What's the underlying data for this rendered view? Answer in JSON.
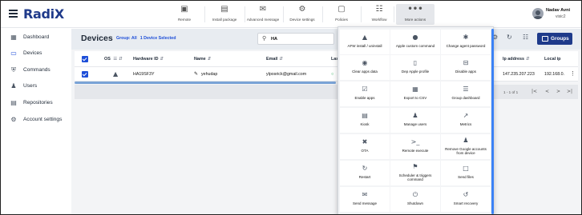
{
  "app": {
    "logo": "RadiX"
  },
  "toolbar": {
    "items": [
      {
        "label": "Remote",
        "icon": "monitor-icon"
      },
      {
        "label": "Install package",
        "icon": "package-icon"
      },
      {
        "label": "Advanced message",
        "icon": "envelope-icon"
      },
      {
        "label": "Device settings",
        "icon": "gear-icon"
      },
      {
        "label": "Policies",
        "icon": "bookmark-icon"
      },
      {
        "label": "Workflow",
        "icon": "workflow-icon"
      },
      {
        "label": "More actions",
        "icon": "more-dots-icon"
      }
    ]
  },
  "user": {
    "name": "Nadav Avni",
    "org": "visic2"
  },
  "sidebar": {
    "items": [
      {
        "label": "Dashboard",
        "icon": "dashboard-icon"
      },
      {
        "label": "Devices",
        "icon": "devices-icon"
      },
      {
        "label": "Commands",
        "icon": "shield-icon"
      },
      {
        "label": "Users",
        "icon": "users-icon"
      },
      {
        "label": "Repositories",
        "icon": "repository-icon"
      },
      {
        "label": "Account settings",
        "icon": "gear-icon"
      }
    ]
  },
  "devices": {
    "title": "Devices",
    "group": "Group: All",
    "selected": "1 Device Selected",
    "search_value": "HA",
    "groups_button": "Groups",
    "columns": [
      "OS",
      "Hardware ID",
      "Name",
      "Email",
      "Las",
      "Ip address",
      "Local ip"
    ],
    "row": {
      "hardware_id": "HA19SF3Y",
      "name": "yehudap",
      "email": "ylposrick@gmail.com",
      "ip": "147.235.207.223",
      "local_ip": "192.168.0."
    },
    "pagination": "1 - 1 of 1"
  },
  "more_actions": {
    "items": [
      {
        "label": "AFW install / uninstall",
        "icon": "android-icon"
      },
      {
        "label": "Apple custom command",
        "icon": "apple-icon"
      },
      {
        "label": "Change agent password",
        "icon": "asterisk-icon"
      },
      {
        "label": "Clear apps data",
        "icon": "clear-data-icon"
      },
      {
        "label": "Dep Apple profile",
        "icon": "phone-icon"
      },
      {
        "label": "Disable apps",
        "icon": "disable-icon"
      },
      {
        "label": "Enable apps",
        "icon": "enable-icon"
      },
      {
        "label": "Export to CSV",
        "icon": "table-icon"
      },
      {
        "label": "Group dashboard",
        "icon": "chart-icon"
      },
      {
        "label": "Kiosk",
        "icon": "kiosk-icon"
      },
      {
        "label": "Manage users",
        "icon": "user-icon"
      },
      {
        "label": "Metrics",
        "icon": "metrics-icon"
      },
      {
        "label": "OTA",
        "icon": "ota-icon"
      },
      {
        "label": "Remote execute",
        "icon": "terminal-icon"
      },
      {
        "label": "Remove Google accounts from device",
        "icon": "remove-user-icon"
      },
      {
        "label": "Restart",
        "icon": "restart-icon"
      },
      {
        "label": "Scheduler & triggers command",
        "icon": "megaphone-icon"
      },
      {
        "label": "Send files",
        "icon": "file-icon"
      },
      {
        "label": "Send message",
        "icon": "message-icon"
      },
      {
        "label": "Shutdown",
        "icon": "power-icon"
      },
      {
        "label": "Smart recovery",
        "icon": "recovery-icon"
      }
    ]
  },
  "colors": {
    "brand": "#1e3a8a",
    "accent": "#1d4ed8",
    "scroll": "#3b82f6"
  }
}
